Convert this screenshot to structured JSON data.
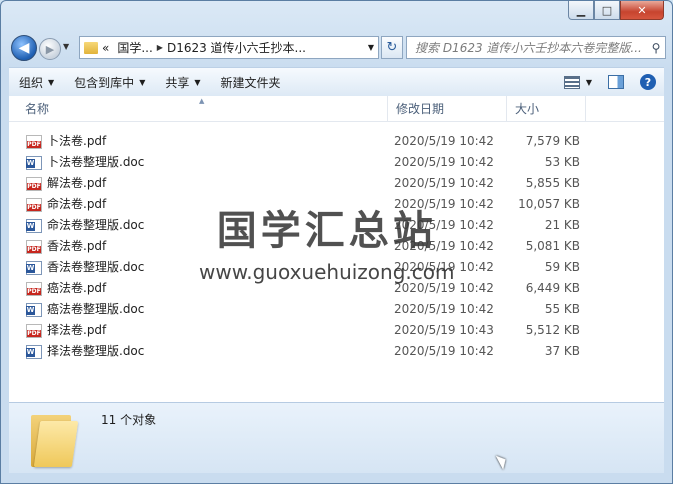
{
  "window": {
    "caption_buttons": {
      "minimize": "▁",
      "maximize": "□",
      "close": "✕"
    }
  },
  "navigation": {
    "back_glyph": "◀",
    "forward_glyph": "▶",
    "recent_glyph": "▼",
    "address": {
      "overflow": "«",
      "crumbs": [
        "国学...",
        "D1623 道传小六壬抄本..."
      ],
      "separator": "▶",
      "dropdown": "▼"
    },
    "refresh_glyph": "↻",
    "search": {
      "placeholder": "搜索 D1623 道传小六壬抄本六卷完整版...",
      "icon": "search-icon"
    }
  },
  "toolbar": {
    "organize": "组织",
    "include_in_library": "包含到库中",
    "share": "共享",
    "new_folder": "新建文件夹",
    "arrow": "▼",
    "help": "?"
  },
  "columns": {
    "name": "名称",
    "date": "修改日期",
    "size": "大小",
    "sort_caret": "▲"
  },
  "files": [
    {
      "name": "卜法卷.pdf",
      "date": "2020/5/19 10:42",
      "size": "7,579 KB",
      "type": "pdf"
    },
    {
      "name": "卜法卷整理版.doc",
      "date": "2020/5/19 10:42",
      "size": "53 KB",
      "type": "doc"
    },
    {
      "name": "解法卷.pdf",
      "date": "2020/5/19 10:42",
      "size": "5,855 KB",
      "type": "pdf"
    },
    {
      "name": "命法卷.pdf",
      "date": "2020/5/19 10:42",
      "size": "10,057 KB",
      "type": "pdf"
    },
    {
      "name": "命法卷整理版.doc",
      "date": "2020/5/19 10:42",
      "size": "21 KB",
      "type": "doc"
    },
    {
      "name": "香法卷.pdf",
      "date": "2020/5/19 10:42",
      "size": "5,081 KB",
      "type": "pdf"
    },
    {
      "name": "香法卷整理版.doc",
      "date": "2020/5/19 10:42",
      "size": "59 KB",
      "type": "doc"
    },
    {
      "name": "癌法卷.pdf",
      "date": "2020/5/19 10:42",
      "size": "6,449 KB",
      "type": "pdf"
    },
    {
      "name": "癌法卷整理版.doc",
      "date": "2020/5/19 10:42",
      "size": "55 KB",
      "type": "doc"
    },
    {
      "name": "择法卷.pdf",
      "date": "2020/5/19 10:43",
      "size": "5,512 KB",
      "type": "pdf"
    },
    {
      "name": "择法卷整理版.doc",
      "date": "2020/5/19 10:42",
      "size": "37 KB",
      "type": "doc"
    }
  ],
  "watermark": {
    "title": "国学汇总站",
    "url": "www.guoxuehuizong.com"
  },
  "details": {
    "count": "11 个对象"
  }
}
